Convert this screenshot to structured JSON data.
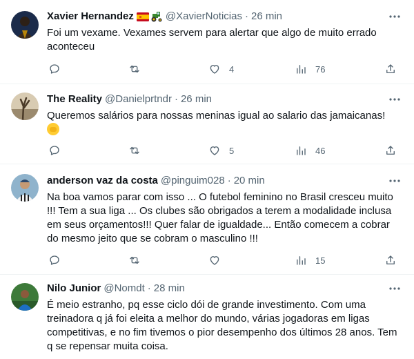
{
  "tweets": [
    {
      "name": "Xavier Hernandez",
      "handle": "@XavierNoticias",
      "time": "26 min",
      "text": "Foi um vexame. Vexames servem para alertar que algo de muito errado aconteceu",
      "likes": "4",
      "views": "76",
      "avatar_color": "#1b2b4a"
    },
    {
      "name": "The Reality",
      "handle": "@Danielprtndr",
      "time": "26 min",
      "text": "Queremos salários para nossas meninas igual ao salario das jamaicanas!",
      "likes": "5",
      "views": "46",
      "avatar_color": "#c9b79a"
    },
    {
      "name": "anderson vaz da costa",
      "handle": "@pinguim028",
      "time": "20 min",
      "text": "Na boa vamos parar com isso ... O futebol feminino no Brasil cresceu muito !!! Tem a sua liga ... Os clubes são obrigados a terem a modalidade inclusa em seus orçamentos!!! Quer falar de igualdade... Então comecem a cobrar do mesmo jeito que se cobram o masculino !!!",
      "likes": "",
      "views": "15",
      "avatar_color": "#6d8fa8"
    },
    {
      "name": "Nilo Junior",
      "handle": "@Nomdt",
      "time": "28 min",
      "text": "É meio estranho, pq esse ciclo dói de grande investimento. Com uma treinadora q já foi eleita a melhor do mundo, várias jogadoras em ligas competitivas, e no fim tivemos o pior desempenho dos últimos 28 anos. Tem q se repensar muita coisa.",
      "avatar_color": "#3d7a3a"
    }
  ],
  "separator": "·",
  "icon_color": "#536471"
}
